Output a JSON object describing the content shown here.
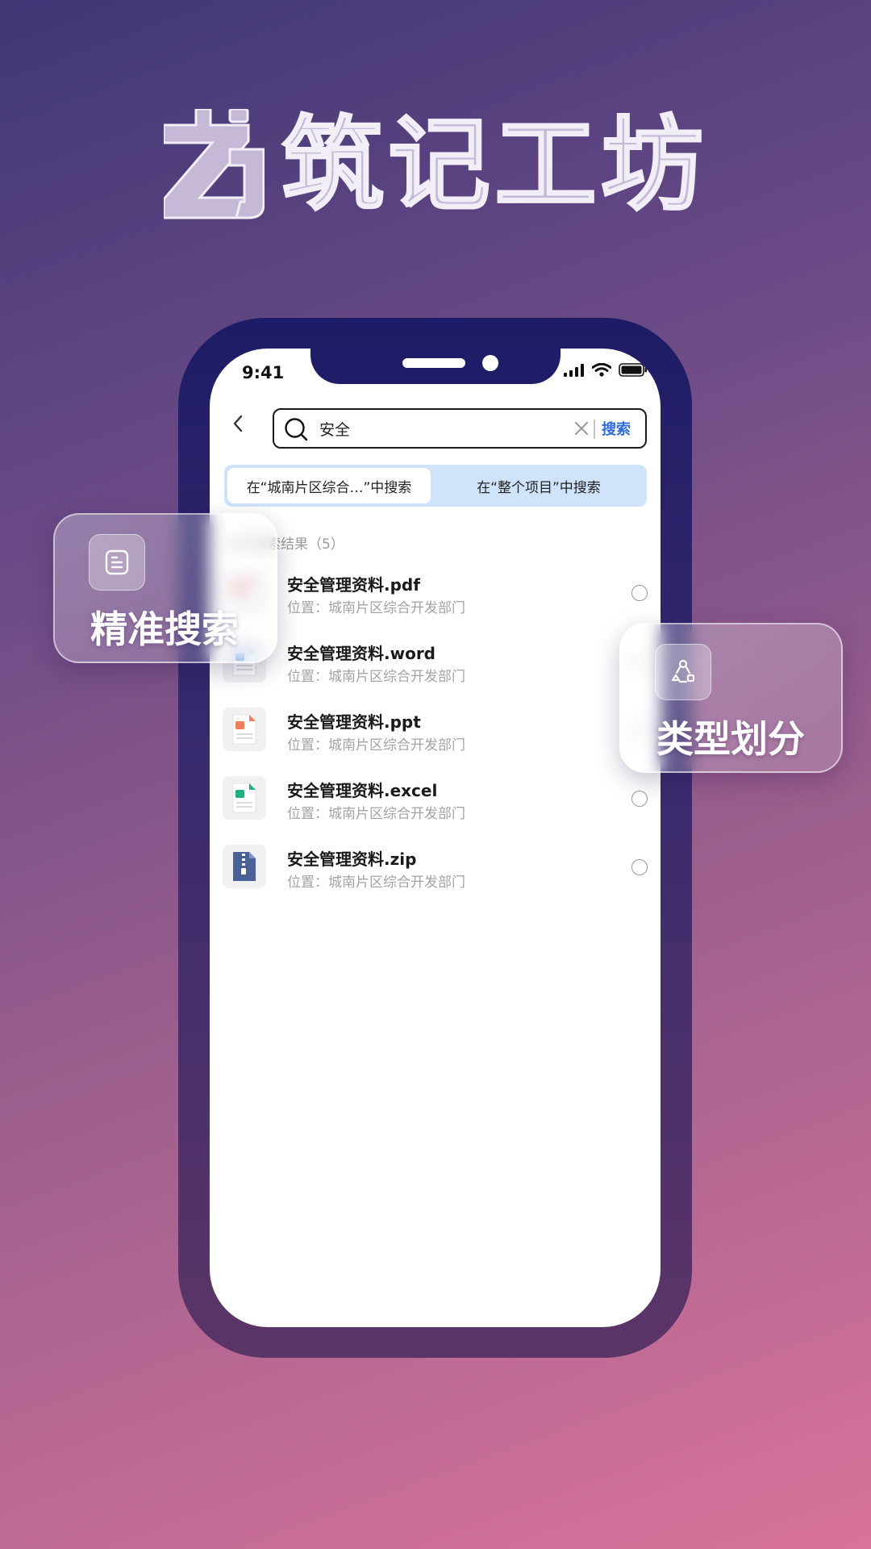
{
  "brand": {
    "title": "筑记工坊"
  },
  "status_bar": {
    "time": "9:41"
  },
  "search": {
    "query": "安全",
    "submit_label": "搜索"
  },
  "scope_tabs": [
    {
      "label": "在“城南片区综合…”中搜索",
      "active": true
    },
    {
      "label": "在“整个项目”中搜索",
      "active": false
    }
  ],
  "results": {
    "count_label": "文件搜索结果（5）",
    "items": [
      {
        "name": "安全管理资料.pdf",
        "location": "位置：城南片区综合开发部门",
        "type": "pdf"
      },
      {
        "name": "安全管理资料.word",
        "location": "位置：城南片区综合开发部门",
        "type": "word"
      },
      {
        "name": "安全管理资料.ppt",
        "location": "位置：城南片区综合开发部门",
        "type": "ppt"
      },
      {
        "name": "安全管理资料.excel",
        "location": "位置：城南片区综合开发部门",
        "type": "excel"
      },
      {
        "name": "安全管理资料.zip",
        "location": "位置：城南片区综合开发部门",
        "type": "zip"
      }
    ]
  },
  "callouts": {
    "left": {
      "label": "精准搜索",
      "icon": "document-list-icon"
    },
    "right": {
      "label": "类型划分",
      "icon": "category-nodes-icon"
    }
  },
  "colors": {
    "accent": "#2f6bd8",
    "tab_bg": "#cfe3fb",
    "phone_frame": "#201d68",
    "pdf": "#e8505b",
    "word": "#3d7be0",
    "ppt": "#f07e5c",
    "excel": "#22b07d",
    "zip": "#4a6196"
  }
}
